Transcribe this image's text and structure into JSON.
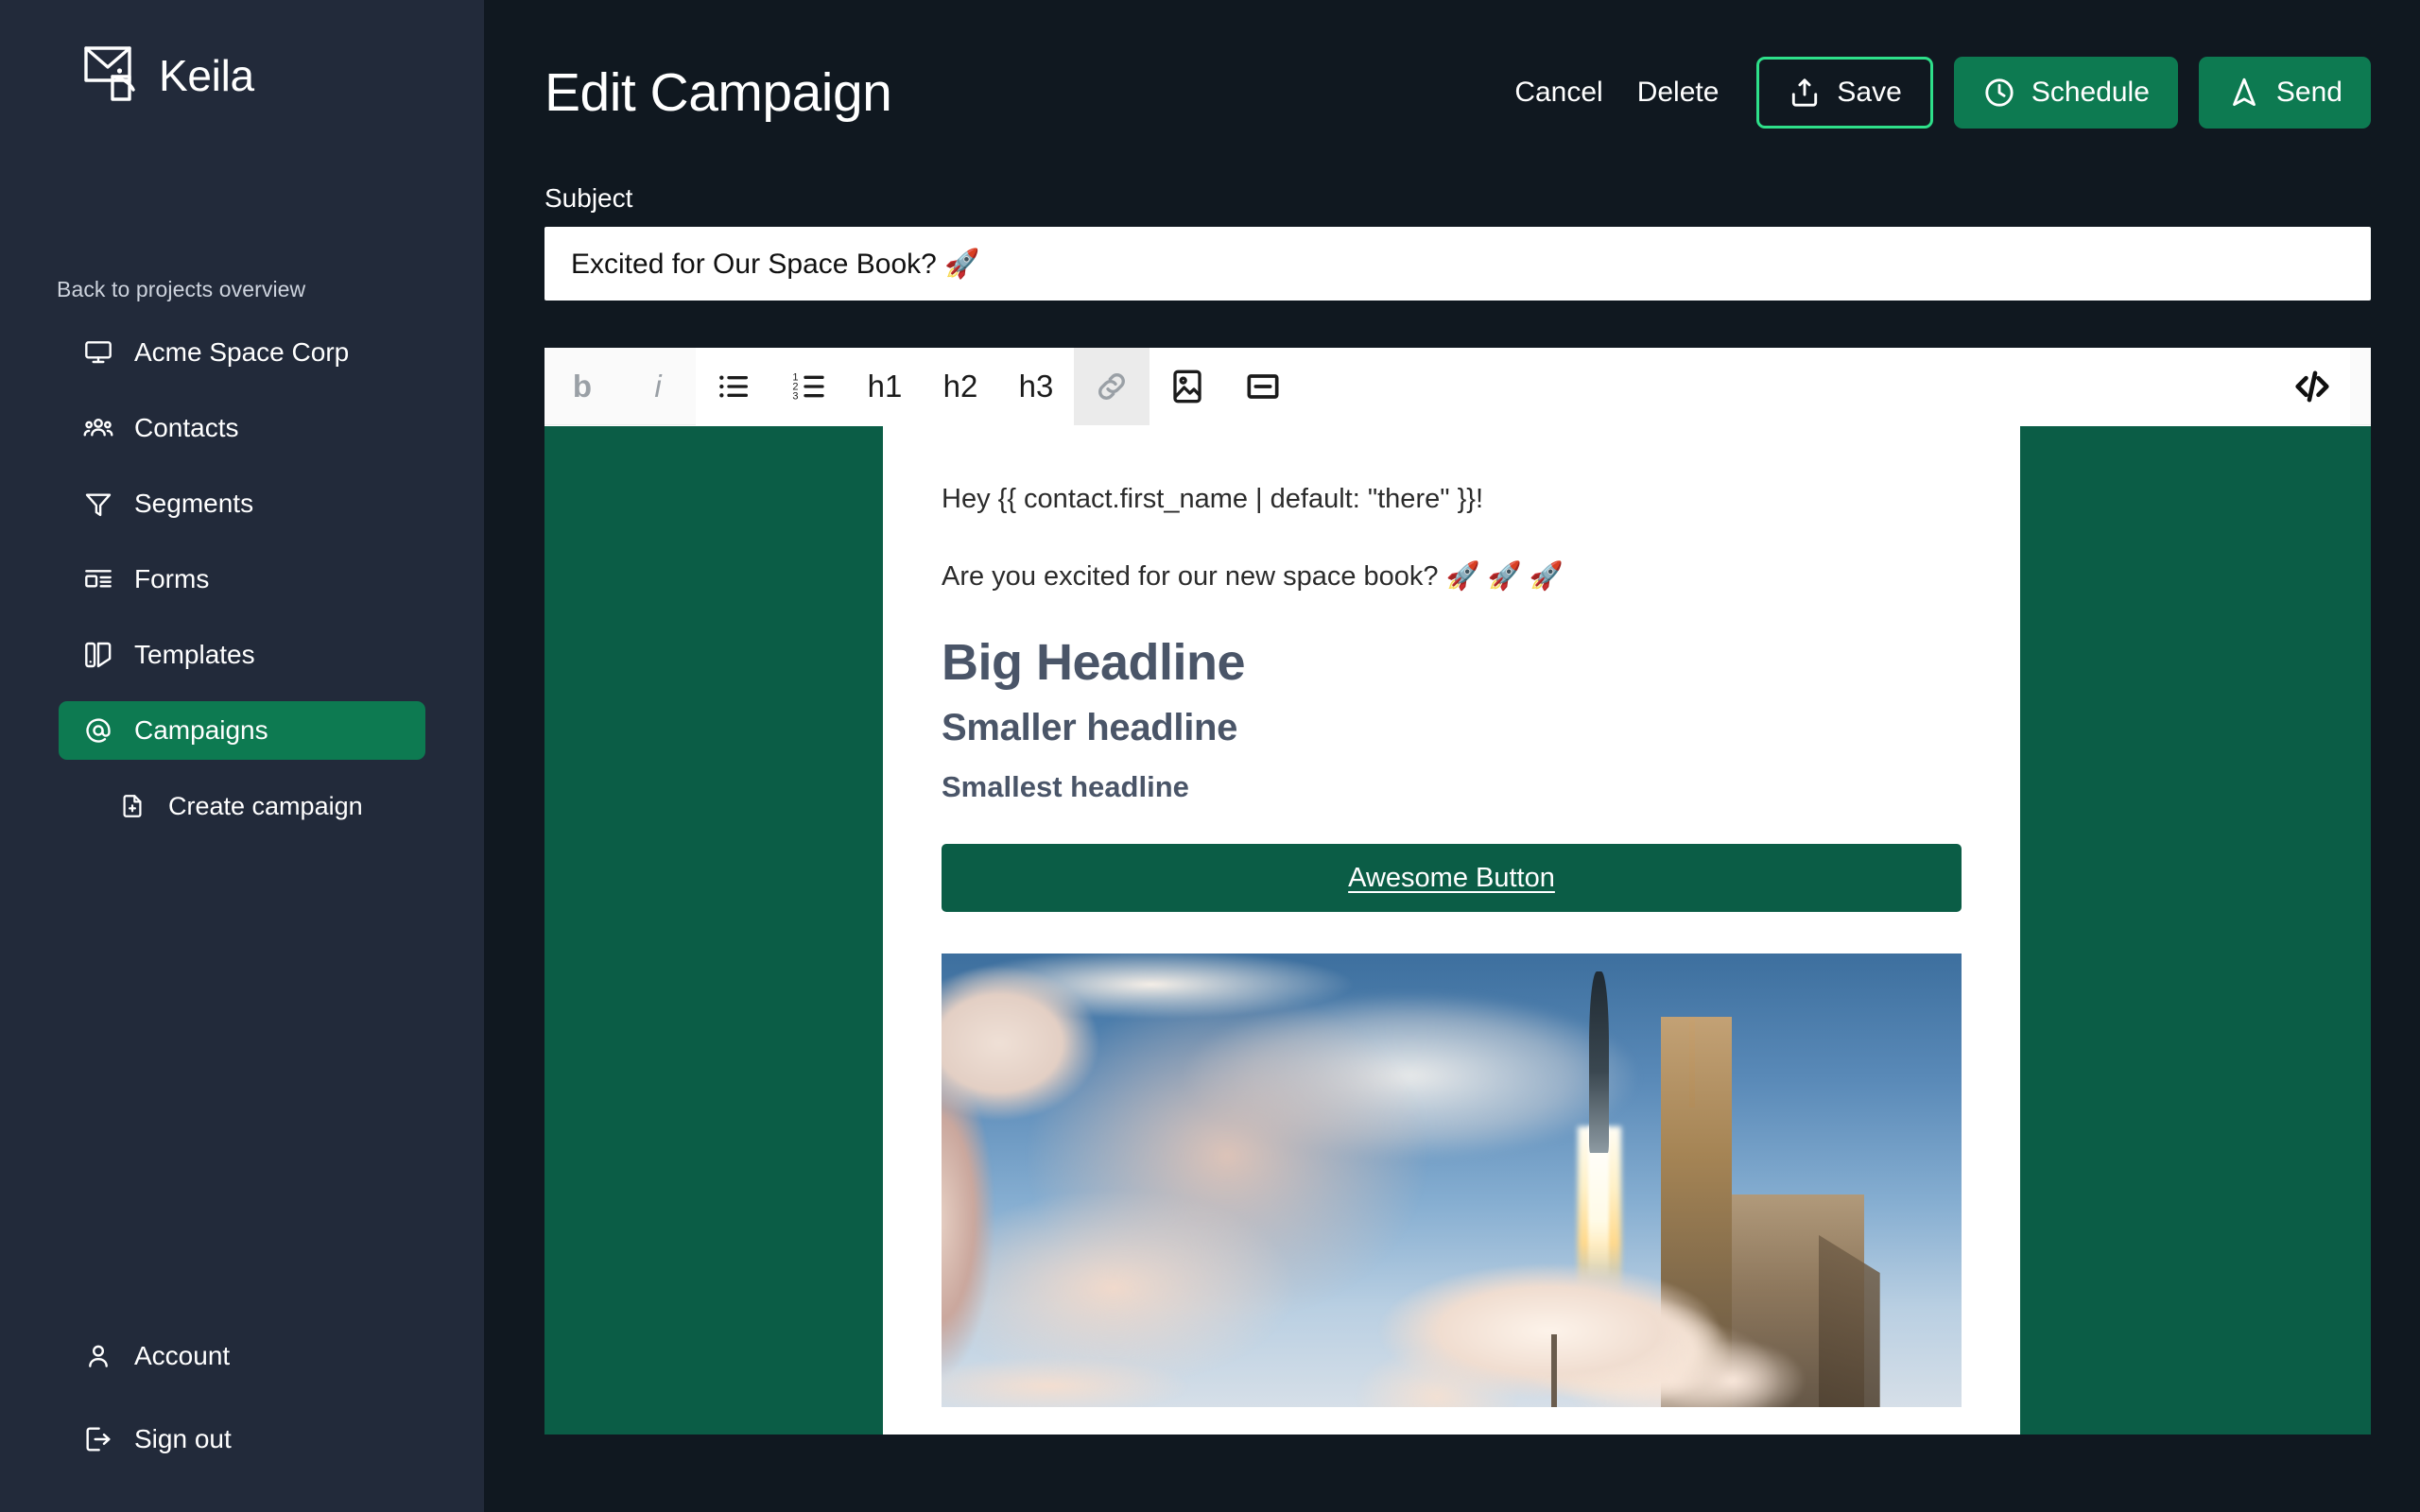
{
  "brand": {
    "name": "Keila",
    "logo_icon": "envelope-logo-icon"
  },
  "sidebar": {
    "back_link": "Back to projects overview",
    "items": [
      {
        "label": "Acme Space Corp",
        "icon": "monitor-icon",
        "active": false
      },
      {
        "label": "Contacts",
        "icon": "users-icon",
        "active": false
      },
      {
        "label": "Segments",
        "icon": "funnel-icon",
        "active": false
      },
      {
        "label": "Forms",
        "icon": "layout-form-icon",
        "active": false
      },
      {
        "label": "Templates",
        "icon": "template-swatch-icon",
        "active": false
      },
      {
        "label": "Campaigns",
        "icon": "at-sign-icon",
        "active": true
      }
    ],
    "sub_item": {
      "label": "Create campaign",
      "icon": "file-plus-icon"
    },
    "bottom_items": [
      {
        "label": "Account",
        "icon": "user-icon"
      },
      {
        "label": "Sign out",
        "icon": "logout-icon"
      }
    ]
  },
  "header": {
    "title": "Edit Campaign",
    "cancel_label": "Cancel",
    "delete_label": "Delete",
    "save_label": "Save",
    "schedule_label": "Schedule",
    "send_label": "Send",
    "save_icon": "save-tray-icon",
    "schedule_icon": "clock-icon",
    "send_icon": "send-arrow-icon"
  },
  "subject": {
    "label": "Subject",
    "value": "Excited for Our Space Book? 🚀",
    "placeholder": "Subject"
  },
  "toolbar": {
    "bold_label": "b",
    "italic_label": "i",
    "bullet_list_icon": "bullet-list-icon",
    "ordered_list_icon": "ordered-list-icon",
    "h1_label": "h1",
    "h2_label": "h2",
    "h3_label": "h3",
    "link_icon": "link-icon",
    "image_icon": "image-icon",
    "divider_icon": "horizontal-rule-icon",
    "code_icon": "code-icon"
  },
  "editor_body": {
    "greeting": "Hey {{ contact.first_name | default: \"there\" }}!",
    "intro": "Are you excited for our new space book? 🚀 🚀 🚀",
    "h1": "Big Headline",
    "h2": "Smaller headline",
    "h3": "Smallest headline",
    "cta_label": "Awesome Button",
    "image_alt": "Rocket launching from a launch pad with exhaust clouds"
  },
  "colors": {
    "sidebar_bg": "#222a3a",
    "main_bg": "#101820",
    "accent_green": "#0d7a51",
    "panel_green": "#0b5d46",
    "save_outline": "#2ee08a",
    "heading_text": "#4a5568"
  }
}
